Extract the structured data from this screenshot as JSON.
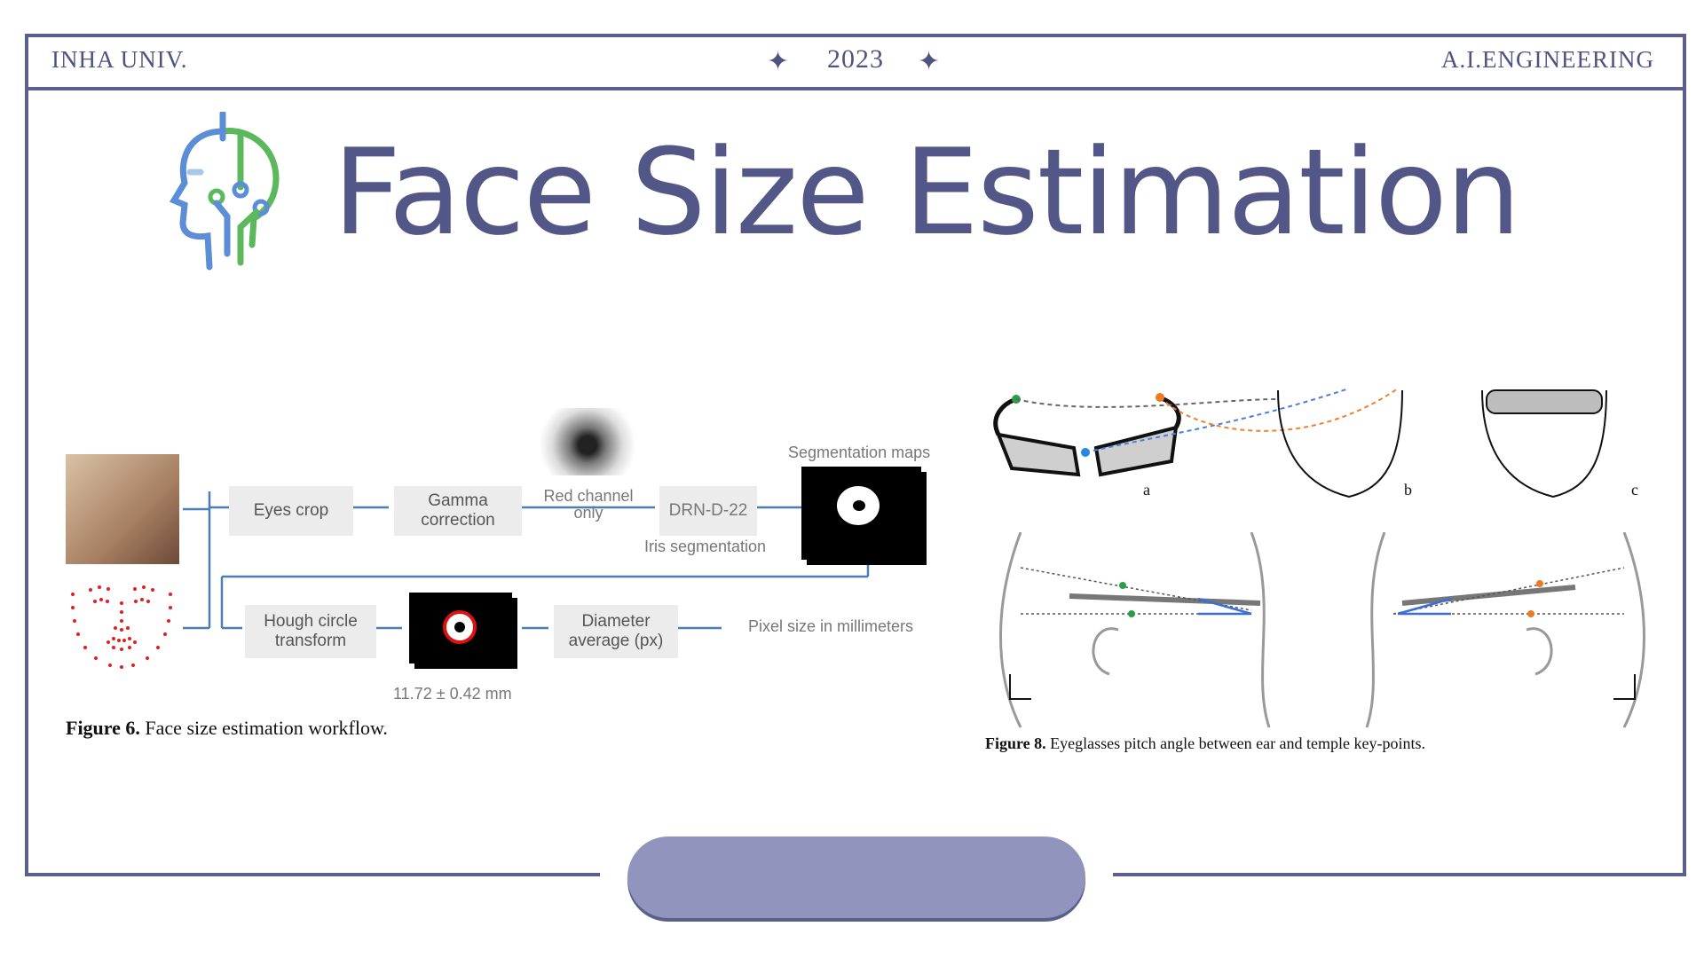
{
  "header": {
    "left": "INHA UNIV.",
    "center": "2023",
    "right": "A.I.ENGINEERING"
  },
  "title": "Face Size Estimation",
  "logo_icon": "ai-head-circuit-icon",
  "figure6": {
    "steps": {
      "eyes_crop": "Eyes crop",
      "gamma": "Gamma correction",
      "red_channel": "Red channel only",
      "drn": "DRN-D-22",
      "iris_seg": "Iris segmentation",
      "seg_maps": "Segmentation maps",
      "hough": "Hough circle transform",
      "diameter": "Diameter average (px)",
      "pixel_size": "Pixel size in millimeters",
      "measure": "11.72 ± 0.42 mm"
    },
    "caption_label": "Figure 6.",
    "caption_text": " Face size estimation workflow."
  },
  "figure8": {
    "labels": {
      "a": "a",
      "b": "b",
      "c": "c"
    },
    "caption_label": "Figure 8.",
    "caption_text": " Eyeglasses pitch angle between ear and temple key-points."
  },
  "colors": {
    "frame": "#5a5f8c",
    "title": "#525788",
    "pill": "#9195bd"
  }
}
